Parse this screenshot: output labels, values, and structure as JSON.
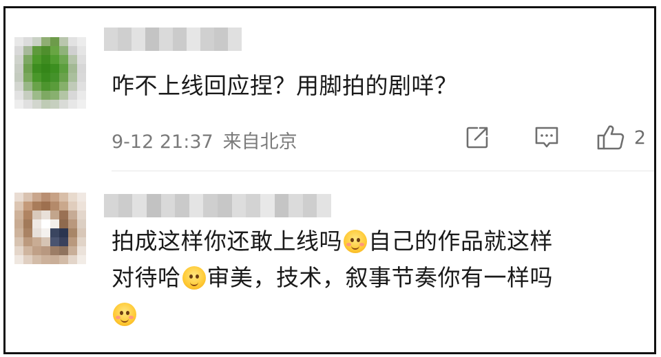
{
  "comments": [
    {
      "text_lines": [
        "咋不上线回应捏？用脚拍的剧咩？"
      ],
      "time": "9-12 21:37",
      "location": "来自北京",
      "like_count": "2",
      "avatar_colors": [
        "#e8e8e8",
        "#dcdcdc",
        "#c9d1c4",
        "#8fae73",
        "#6d9b4a",
        "#b9c6ad",
        "#e2e2e2",
        "#ececec",
        "#d9d9d9",
        "#a7b99a",
        "#5e9a3b",
        "#4f8f2d",
        "#68a543",
        "#8fb27a",
        "#d0d0d0",
        "#e5e5e5",
        "#cfd3cc",
        "#7ea864",
        "#4d9a2a",
        "#3f8c20",
        "#519d30",
        "#6fa852",
        "#b5c4aa",
        "#dedede",
        "#c8cdc4",
        "#6ea04f",
        "#3d8d1f",
        "#358619",
        "#3c8f20",
        "#5c9f3e",
        "#a3b994",
        "#d7d7d7",
        "#c4cbbf",
        "#7aa85c",
        "#4a972a",
        "#3a8b1e",
        "#44922a",
        "#6aa24c",
        "#aabf9d",
        "#d9d9d9",
        "#d3d6d0",
        "#99b787",
        "#6aa34a",
        "#4d952e",
        "#5a9c3b",
        "#86b06b",
        "#c0cab8",
        "#e0e0e0",
        "#e2e2e2",
        "#c6cdc0",
        "#9dbb8a",
        "#7ea963",
        "#88b06f",
        "#b3c5a5",
        "#d8d8d8",
        "#eaeaea",
        "#ededed",
        "#e0e0e0",
        "#d2d6ce",
        "#bfcbb5",
        "#c6cfbf",
        "#d9dbd7",
        "#e7e7e7",
        "#f0f0f0"
      ],
      "name_colors": [
        "#d8d8d8",
        "#cfcfcf",
        "#e2e2e2",
        "#c4c4c4",
        "#dadada",
        "#cbcbcb",
        "#e6e6e6",
        "#d0d0d0",
        "#c9c9c9",
        "#e0e0e0"
      ]
    },
    {
      "text_lines": [
        "拍成这样你还敢上线吗",
        "自己的作品就这样",
        "对待哈",
        "审美，技术，叙事节奏你有一样吗"
      ],
      "avatar_colors": [
        "#e9dcd2",
        "#d9c2b0",
        "#c9a68c",
        "#b98f72",
        "#c7a286",
        "#d8bea8",
        "#e8dacd",
        "#f0e8e2",
        "#dcc5b2",
        "#c49a7a",
        "#a97c5a",
        "#9e704f",
        "#b48a6a",
        "#caa88c",
        "#e0cdbd",
        "#ede2d9",
        "#ceb29a",
        "#b08462",
        "#d9c9bb",
        "#e8e0d8",
        "#c2a58c",
        "#9a7154",
        "#c6ab95",
        "#e3d6cb",
        "#c8ab92",
        "#a27a5a",
        "#efe9e4",
        "#ffffff",
        "#f2eeea",
        "#8f6a4e",
        "#b9987d",
        "#dccfc3",
        "#cdb39c",
        "#aa8364",
        "#e7e0da",
        "#f4f1ee",
        "#3a4560",
        "#2b3550",
        "#a88668",
        "#d8c7b8",
        "#d7c3b1",
        "#bc9a7e",
        "#c9ac94",
        "#d6c4b4",
        "#4a5470",
        "#39415c",
        "#b9997e",
        "#e1d4c8",
        "#e4d6ca",
        "#cfb59f",
        "#c0a087",
        "#b89880",
        "#9c7d66",
        "#8f735e",
        "#c8ae98",
        "#ebe2da",
        "#efe7e0",
        "#e0cfc1",
        "#d3bca8",
        "#ccb19b",
        "#c9ae98",
        "#d2bba7",
        "#e3d5c9",
        "#f2ece6"
      ],
      "name_colors": [
        "#d6d6d6",
        "#cccccc",
        "#e1e1e1",
        "#c2c2c2",
        "#d9d9d9",
        "#cacaca",
        "#e4e4e4",
        "#cfcfcf",
        "#c7c7c7",
        "#dddddd",
        "#d3d3d3",
        "#e8e8e8",
        "#c5c5c5",
        "#dbdbdb",
        "#cecece",
        "#e3e3e3"
      ]
    }
  ],
  "icons": {
    "share": "share-icon",
    "reply": "comment-icon",
    "like": "thumbs-up-icon",
    "emoji_1": "face-hands-on-cheeks-icon",
    "emoji_2": "smiling-face-icon"
  },
  "colors": {
    "text": "#1a1a1a",
    "meta": "#7a7a7a",
    "frame": "#111111",
    "divider": "#e6e6e6"
  }
}
